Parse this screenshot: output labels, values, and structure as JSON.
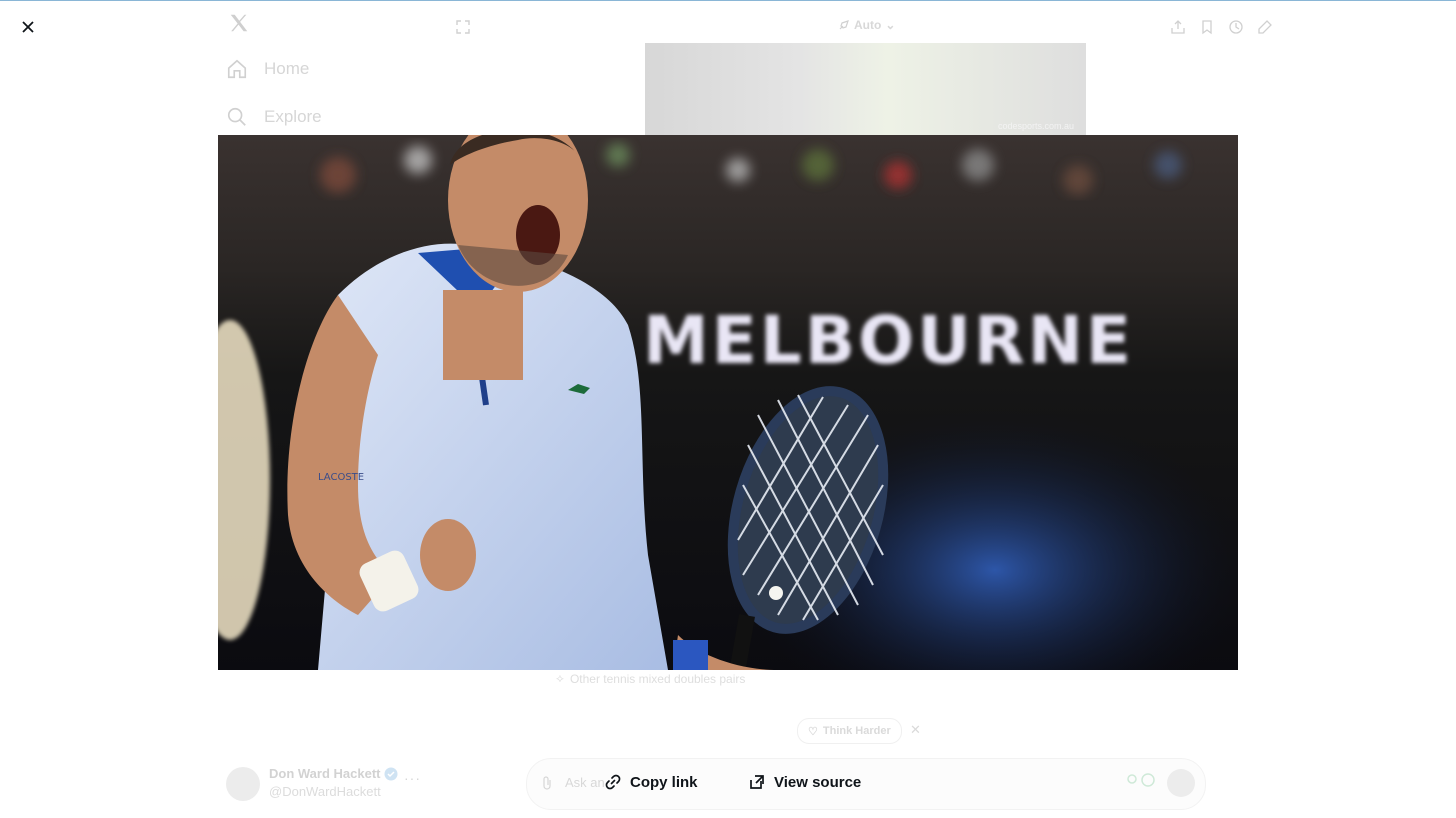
{
  "lightbox": {
    "close_icon": "close-icon",
    "image_alt": "Tennis player in a light blue polo celebrating with a clenched fist, holding a racket, in front of a MELBOURNE sign",
    "image_sign_text": "MELBOURNE",
    "actions": {
      "copy_link": "Copy link",
      "view_source": "View source"
    }
  },
  "background": {
    "nav": {
      "home": "Home",
      "explore": "Explore"
    },
    "model_selector": "Auto",
    "thumbnail_credit": "codesports.com.au",
    "related_suggestion": "Other tennis mixed doubles pairs",
    "think_harder": "Think Harder",
    "user": {
      "name": "Don Ward Hackett",
      "handle": "@DonWardHackett"
    },
    "input_placeholder": "Ask an"
  },
  "colors": {
    "accent": "#1d9bf0",
    "text": "#0f1419",
    "photo_bg": "#101010"
  }
}
